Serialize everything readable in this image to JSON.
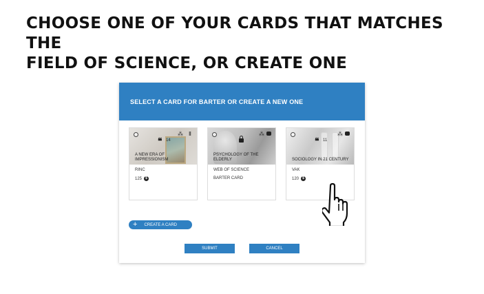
{
  "heading": {
    "line1": "CHOOSE ONE OF YOUR CARDS THAT MATCHES THE",
    "line2": "FIELD OF SCIENCE, OR CREATE ONE"
  },
  "dialog": {
    "title": "SELECT A CARD FOR BARTER OR CREATE A NEW ONE",
    "accent_color": "#2f80c2",
    "cards": [
      {
        "title_line1": "A NEW ERA OF",
        "title_line2": "IMPRESSIONISM",
        "quote_count": "14",
        "source": "RINC",
        "value": "125",
        "icons": [
          "radio-icon",
          "quote-icon",
          "share-icon",
          "pillar-icon"
        ]
      },
      {
        "title_line1": "PSYCHOLOGY OF THE",
        "title_line2": "ELDERLY",
        "source": "WEB OF SCIENCE",
        "subtitle": "BARTER CARD",
        "icons": [
          "radio-icon",
          "lock-icon",
          "share-icon",
          "chat-icon"
        ]
      },
      {
        "title_line1": "SOCIOLOGY IN 21 CENTURY",
        "quote_count": "11",
        "source": "VAK",
        "value": "120",
        "icons": [
          "radio-icon",
          "quote-icon",
          "share-icon",
          "chat-icon"
        ]
      }
    ],
    "create_button_label": "CREATE A CARD",
    "submit_label": "SUBMIT",
    "cancel_label": "CANCEL"
  },
  "cursor": "hand-pointer-icon"
}
